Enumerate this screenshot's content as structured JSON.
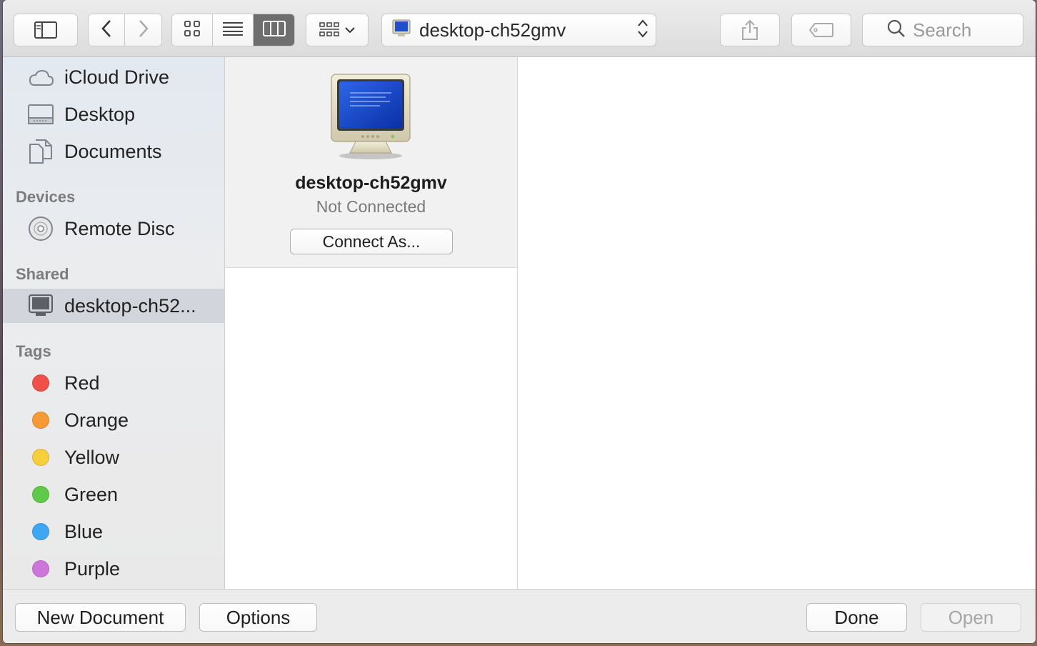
{
  "toolbar": {
    "path_label": "desktop-ch52gmv",
    "search_placeholder": "Search",
    "view_mode_selected": "column-view"
  },
  "sidebar": {
    "favorites": [
      {
        "label": "iCloud Drive",
        "icon": "cloud-icon"
      },
      {
        "label": "Desktop",
        "icon": "desktop-icon"
      },
      {
        "label": "Documents",
        "icon": "document-icon"
      }
    ],
    "devices_title": "Devices",
    "devices": [
      {
        "label": "Remote Disc",
        "icon": "disc-icon"
      }
    ],
    "shared_title": "Shared",
    "shared": [
      {
        "label": "desktop-ch52...",
        "icon": "computer-icon",
        "selected": true
      }
    ],
    "tags_title": "Tags",
    "tags": [
      {
        "label": "Red",
        "color": "#f0504a"
      },
      {
        "label": "Orange",
        "color": "#f59a35"
      },
      {
        "label": "Yellow",
        "color": "#f5cf3c"
      },
      {
        "label": "Green",
        "color": "#5fc94a"
      },
      {
        "label": "Blue",
        "color": "#3ea6f2"
      },
      {
        "label": "Purple",
        "color": "#cc76db"
      }
    ]
  },
  "server": {
    "name": "desktop-ch52gmv",
    "status": "Not Connected",
    "connect_label": "Connect As..."
  },
  "bottom": {
    "new_document_label": "New Document",
    "options_label": "Options",
    "done_label": "Done",
    "open_label": "Open"
  }
}
